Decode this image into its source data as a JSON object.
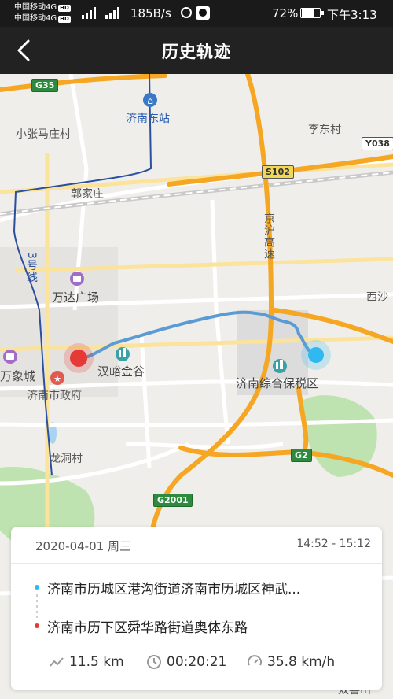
{
  "status_bar": {
    "carrier1": "中国移动4G",
    "carrier2": "中国移动4G",
    "hd_label": "HD",
    "net_speed": "185B/s",
    "battery_pct": "72%",
    "battery_level": 0.72,
    "time": "下午3:13"
  },
  "header": {
    "title": "历史轨迹",
    "back_icon": "chevron-left-icon"
  },
  "map": {
    "places": {
      "jinan_east_station": "济南东站",
      "xiaozhangmazhuang": "小张马庄村",
      "lidongcun": "李东村",
      "guojiazhuang": "郭家庄",
      "wanda": "万达广场",
      "xisha": "西沙",
      "hanyu_jingu": "汉峪金谷",
      "wanxiangcheng": "万象城",
      "city_gov": "济南市政府",
      "bonded_zone": "济南综合保税区",
      "longdongcun": "龙洞村",
      "shuangxuan": "双喜山"
    },
    "roads": {
      "g35": "G35",
      "y038": "Y038",
      "s102": "S102",
      "g2": "G2",
      "g2001": "G2001",
      "jinghu": "京沪高速",
      "metro3": "3号线"
    },
    "colors": {
      "track": "#5b9bd5",
      "start_marker": "#e53935",
      "end_marker": "#30b9f0",
      "highway": "#f5a623",
      "metro_line": "#2c4f9e"
    }
  },
  "trip": {
    "date": "2020-04-01 周三",
    "time_range": "14:52 - 15:12",
    "start_address": "济南市历城区港沟街道济南市历城区神武...",
    "end_address": "济南市历下区舜华路街道奥体东路",
    "distance": "11.5 km",
    "duration": "00:20:21",
    "avg_speed": "35.8 km/h",
    "icons": {
      "distance": "route-zigzag-icon",
      "duration": "clock-icon",
      "speed": "speedometer-icon"
    }
  }
}
